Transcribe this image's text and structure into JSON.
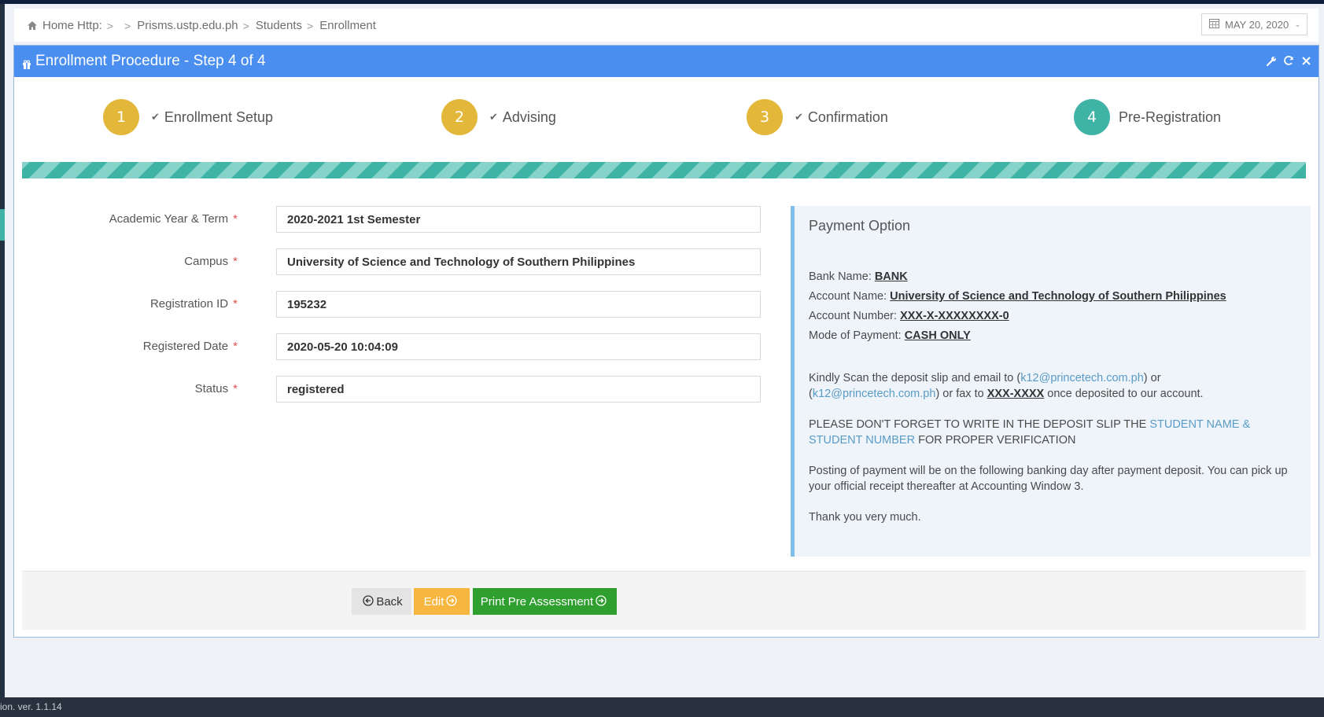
{
  "breadcrumb": {
    "items": [
      "Home Http:",
      "",
      "Prisms.ustp.edu.ph",
      "Students",
      "Enrollment"
    ],
    "separator": ">"
  },
  "date_picker": {
    "value": "MAY 20, 2020"
  },
  "panel": {
    "title": "Enrollment Procedure - Step 4 of 4",
    "header_color": "#4a8ef0",
    "tools": [
      "wrench-icon",
      "refresh-icon",
      "close-icon"
    ]
  },
  "steps": [
    {
      "number": "1",
      "label": "Enrollment Setup",
      "done": true
    },
    {
      "number": "2",
      "label": "Advising",
      "done": true
    },
    {
      "number": "3",
      "label": "Confirmation",
      "done": true
    },
    {
      "number": "4",
      "label": "Pre-Registration",
      "done": false
    }
  ],
  "step_colors": {
    "done": "#e3b83a",
    "active": "#3fb3a5"
  },
  "form": {
    "fields": [
      {
        "label": "Academic Year & Term",
        "required": "*",
        "value": "2020-2021 1st Semester"
      },
      {
        "label": "Campus",
        "required": "*",
        "value": "University of Science and Technology of Southern Philippines"
      },
      {
        "label": "Registration ID",
        "required": "*",
        "value": "195232"
      },
      {
        "label": "Registered Date",
        "required": "*",
        "value": "2020-05-20 10:04:09"
      },
      {
        "label": "Status",
        "required": "*",
        "value": "registered"
      }
    ]
  },
  "payment": {
    "title": "Payment Option",
    "bank_label": "Bank Name:",
    "bank_value": "BANK",
    "account_name_label": "Account Name:",
    "account_name_value": "University of Science and Technology of Southern Philippines",
    "account_number_label": "Account Number:",
    "account_number_value": "XXX-X-XXXXXXXX-0",
    "mode_label": "Mode of Payment:",
    "mode_value": "CASH ONLY",
    "scan_text_1": "Kindly Scan the deposit slip and email to (",
    "email_1": "k12@princetech.com.ph",
    "scan_text_2": ") or (",
    "email_2": "k12@princetech.com.ph",
    "scan_text_3": ") or fax to ",
    "fax_value": "XXX-XXXX",
    "scan_text_4": " once deposited to our account.",
    "reminder_text_1": "PLEASE DON'T FORGET TO WRITE IN THE DEPOSIT SLIP THE ",
    "reminder_highlight": "STUDENT NAME & STUDENT NUMBER",
    "reminder_text_2": " FOR PROPER VERIFICATION",
    "posting_text": "Posting of payment will be on the following banking day after payment deposit. You can pick up your official receipt thereafter at Accounting Window 3.",
    "thanks_text": "Thank you very much."
  },
  "actions": {
    "back_label": "Back",
    "edit_label": "Edit",
    "print_label": "Print Pre Assessment"
  },
  "footer": {
    "text": "ion. ver. 1.1.14"
  }
}
